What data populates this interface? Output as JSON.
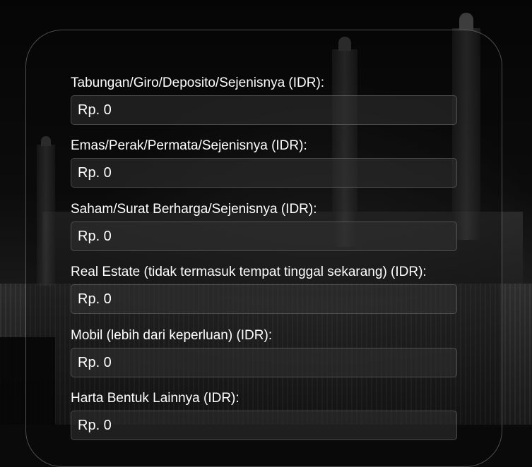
{
  "form": {
    "fields": [
      {
        "label": "Tabungan/Giro/Deposito/Sejenisnya (IDR):",
        "placeholder": "Rp. 0"
      },
      {
        "label": "Emas/Perak/Permata/Sejenisnya (IDR):",
        "placeholder": "Rp. 0"
      },
      {
        "label": "Saham/Surat Berharga/Sejenisnya (IDR):",
        "placeholder": "Rp. 0"
      },
      {
        "label": "Real Estate (tidak termasuk tempat tinggal sekarang) (IDR):",
        "placeholder": "Rp. 0"
      },
      {
        "label": "Mobil (lebih dari keperluan) (IDR):",
        "placeholder": "Rp. 0"
      },
      {
        "label": "Harta Bentuk Lainnya (IDR):",
        "placeholder": "Rp. 0"
      }
    ]
  }
}
